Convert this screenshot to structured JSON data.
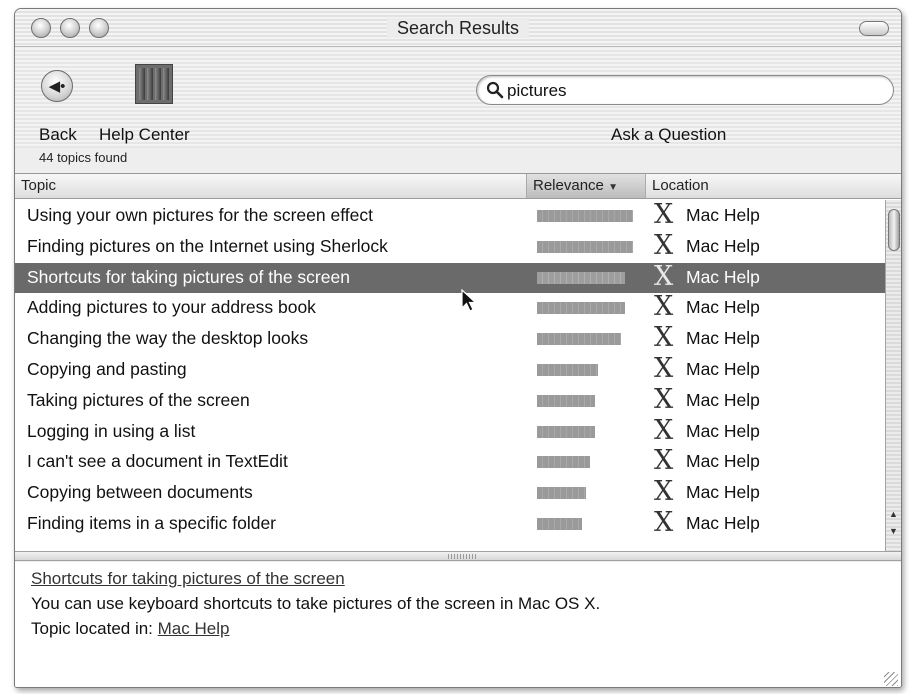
{
  "window": {
    "title": "Search Results"
  },
  "toolbar": {
    "back_label": "Back",
    "help_center_label": "Help Center",
    "ask_label": "Ask a Question",
    "search_value": "pictures"
  },
  "results": {
    "count_text": "44 topics found",
    "columns": {
      "topic": "Topic",
      "relevance": "Relevance",
      "location": "Location"
    },
    "rows": [
      {
        "topic": "Using your own pictures for the screen effect",
        "relevance": 1.0,
        "location": "Mac Help"
      },
      {
        "topic": "Finding pictures on the Internet using Sherlock",
        "relevance": 1.0,
        "location": "Mac Help"
      },
      {
        "topic": "Shortcuts for taking pictures of the screen",
        "relevance": 0.92,
        "location": "Mac Help",
        "selected": true
      },
      {
        "topic": "Adding pictures to your address book",
        "relevance": 0.92,
        "location": "Mac Help"
      },
      {
        "topic": "Changing the way the desktop looks",
        "relevance": 0.88,
        "location": "Mac Help"
      },
      {
        "topic": "Copying and pasting",
        "relevance": 0.64,
        "location": "Mac Help"
      },
      {
        "topic": "Taking pictures of the screen",
        "relevance": 0.6,
        "location": "Mac Help"
      },
      {
        "topic": "Logging in using a list",
        "relevance": 0.6,
        "location": "Mac Help"
      },
      {
        "topic": "I can't see a document in TextEdit",
        "relevance": 0.55,
        "location": "Mac Help"
      },
      {
        "topic": "Copying between documents",
        "relevance": 0.51,
        "location": "Mac Help"
      },
      {
        "topic": "Finding items in a specific folder",
        "relevance": 0.47,
        "location": "Mac Help"
      }
    ]
  },
  "detail": {
    "title": "Shortcuts for taking pictures of the screen",
    "description": "You can use keyboard shortcuts to take pictures of the screen in Mac OS X.",
    "location_prefix": "Topic located in:",
    "location_link": "Mac Help"
  }
}
